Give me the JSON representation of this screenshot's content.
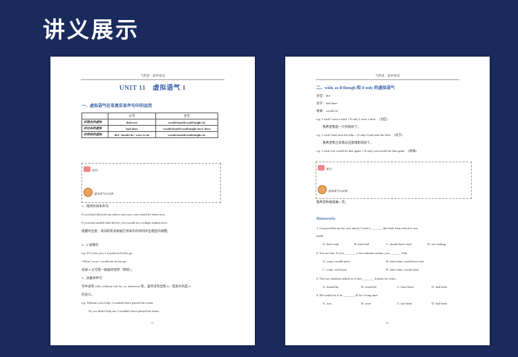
{
  "banner_title": "讲义展示",
  "left_page": {
    "header": "飞英语　高中语法",
    "unit_title": "UNIT 11　虚拟语气 1",
    "section1": "一、虚拟语气在非真实条件句中的运用",
    "table": {
      "headers": [
        "",
        "从句",
        "主句"
      ],
      "rows": [
        [
          "对现在的虚拟",
          "did/were",
          "would/should/could/might do"
        ],
        [
          "对过去的虚拟",
          "had done",
          "would/should/could/might have done"
        ],
        [
          "对将来的虚拟",
          "did / should do / were to do",
          "would/should/could/might do"
        ]
      ]
    },
    "note1_label": "笔记：",
    "note2_label": "虚拟语气公式表",
    "lines": [
      "1、错综时间条件句",
      "If you had followed my advice just now, you would be better now.",
      "If you had studied hard before, you would be a college student now.",
      "提醒时注意：动词的形式根据它所表示的时间作出相应的调整。",
      "2、if 省略句",
      "e.g. If I were you, I would not let her go.",
      "=Were I you, I would not let her go.",
      "去掉 if 从句变一般疑问语序（倒装）。",
      "3、含蓄条件句",
      "句中含有 with, without, but for, or, otherwise 等，虽然没有出现 if，但表示的是 if",
      "的含义。",
      "e.g. Without your help, I wouldn't have passed the exam.",
      "=If you didn't help me, I wouldn't have passed the exam."
    ],
    "page_number": "61"
  },
  "right_page": {
    "header": "飞英语　高中语法",
    "section_title": "二、wish, as if/though 和 if only 的虚拟语气",
    "lines": [
      "对应：did",
      "对于：had done",
      "将来：would do",
      "e.g. I wish I were a bird. / If only I were a bird.　(对应)",
      "我希望我是一只鸟就好了。",
      "e.g. I wish I had seen the film. / If only I had seen the film.　(对于)",
      "我希望我之前看过这部电影就好了。",
      "e.g. I wish you would do that again. / If only you would do that again.　(将来)"
    ],
    "note1_label": "笔记：",
    "note2_label": "虚拟语气公式表",
    "after_note": "我希望你能再做一次。",
    "homework_title": "Homework:",
    "questions": [
      {
        "q": "1. I enjoyed the movie very much. I wish I _______ the book from which it was",
        "q2": "made.",
        "opts": [
          "A. have read",
          "B. had read",
          "C. should have read",
          "D. are reading"
        ]
      },
      {
        "q": "2. You are late. If you _______ a few minutes earlier, you _______ him.",
        "opts": [
          "A. come; would meet",
          "B. had come; would have met",
          "C. come; will meet",
          "D. had come; would meet"
        ]
      },
      {
        "q": "3. The two students talked as if they _______ friends for years.",
        "opts": [
          "A. should be",
          "B. would be",
          "C. have been",
          "D. had been"
        ]
      },
      {
        "q": "4. He looked as if he _______ ill for a long time.",
        "opts": [
          "A. was",
          "B. were",
          "C. has been",
          "D. had been"
        ]
      }
    ],
    "page_number": "62"
  }
}
